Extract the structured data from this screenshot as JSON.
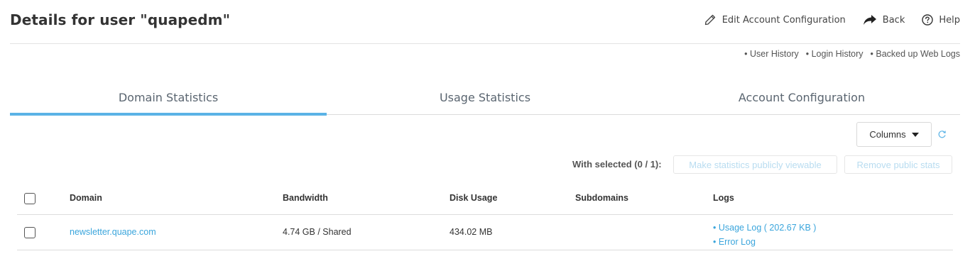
{
  "header": {
    "title": "Details for user \"quapedm\"",
    "actions": {
      "edit": "Edit Account Configuration",
      "back": "Back",
      "help": "Help"
    }
  },
  "sublinks": [
    "• User History",
    "• Login History",
    "• Backed up Web Logs"
  ],
  "tabs": [
    {
      "label": "Domain Statistics",
      "active": true
    },
    {
      "label": "Usage Statistics",
      "active": false
    },
    {
      "label": "Account Configuration",
      "active": false
    }
  ],
  "toolbar": {
    "columns_label": "Columns",
    "with_selected": "With selected (0 / 1):",
    "make_public_label": "Make statistics publicly viewable",
    "remove_public_label": "Remove public stats"
  },
  "table": {
    "headers": [
      "Domain",
      "Bandwidth",
      "Disk Usage",
      "Subdomains",
      "Logs"
    ],
    "rows": [
      {
        "domain": "newsletter.quape.com",
        "bandwidth": "4.74 GB / Shared",
        "disk_usage": "434.02 MB",
        "subdomains": "",
        "logs": [
          "• Usage Log ( 202.67 KB )",
          "• Error Log"
        ]
      }
    ]
  },
  "colors": {
    "accent": "#5bb3e6",
    "link": "#3aa5dc",
    "disabled_text": "#b8dcf0"
  }
}
